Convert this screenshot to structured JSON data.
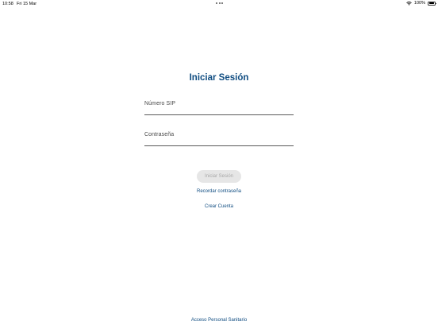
{
  "status_bar": {
    "time": "10:58",
    "date": "Fri 15 Mar",
    "battery": "100%",
    "icons": [
      "wifi-icon",
      "battery-icon",
      "multitasking-dots-icon"
    ]
  },
  "login": {
    "title": "Iniciar Sesión",
    "sip_label": "Número SIP",
    "sip_value": "",
    "password_label": "Contraseña",
    "password_value": "",
    "submit_label": "Iniciar Sesión",
    "recover_password_label": "Recordar contraseña",
    "create_account_label": "Crear Cuenta"
  },
  "footer": {
    "staff_access_label": "Acceso Personal Sanitario"
  },
  "colors": {
    "accent": "#0f4c81",
    "button_disabled_bg": "#e6e6e6",
    "button_disabled_text": "#a8a8a8"
  }
}
